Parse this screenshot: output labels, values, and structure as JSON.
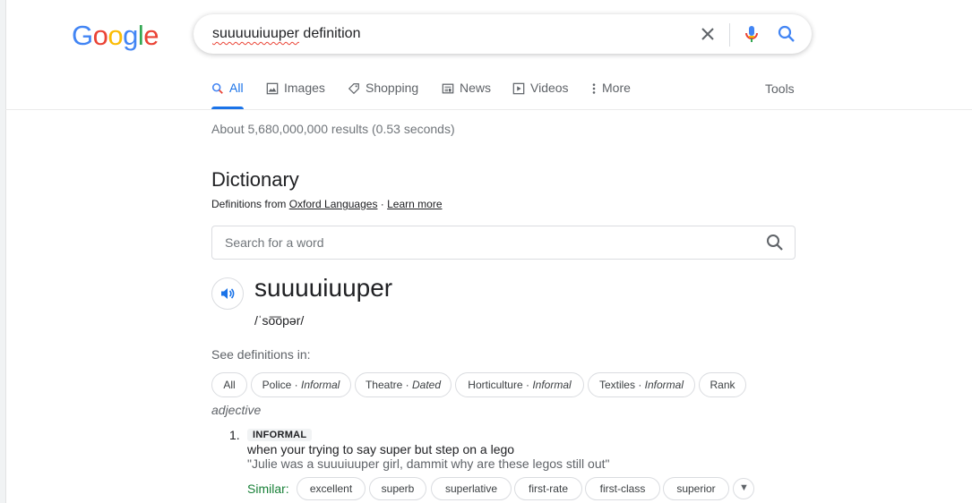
{
  "logo": {
    "letters": [
      "G",
      "o",
      "o",
      "g",
      "l",
      "e"
    ]
  },
  "search": {
    "query": "suuuuuiuuper",
    "query_rest": " definition",
    "clear_icon": "close-icon",
    "voice_icon": "mic-icon",
    "search_icon": "search-icon"
  },
  "tabs": [
    {
      "label": "All",
      "icon": "search-icon"
    },
    {
      "label": "Images",
      "icon": "image-icon"
    },
    {
      "label": "Shopping",
      "icon": "tag-icon"
    },
    {
      "label": "News",
      "icon": "newspaper-icon"
    },
    {
      "label": "Videos",
      "icon": "play-icon"
    },
    {
      "label": "More",
      "icon": "more-vert-icon"
    }
  ],
  "tools_label": "Tools",
  "stats": "About 5,680,000,000 results (0.53 seconds)",
  "dictionary": {
    "title": "Dictionary",
    "source_prefix": "Definitions from ",
    "source_link": "Oxford Languages",
    "source_sep": " · ",
    "learn_more": "Learn more",
    "word_search_placeholder": "Search for a word",
    "headword": "suuuuiuuper",
    "phonetic": "/ˈso͞opər/",
    "see_defs_label": "See definitions in:",
    "domains": [
      {
        "label": "All",
        "tag": ""
      },
      {
        "label": "Police",
        "tag": "Informal"
      },
      {
        "label": "Theatre",
        "tag": "Dated"
      },
      {
        "label": "Horticulture",
        "tag": "Informal"
      },
      {
        "label": "Textiles",
        "tag": "Informal"
      },
      {
        "label": "Rank",
        "tag": ""
      }
    ],
    "tag_sep": " · ",
    "part_of_speech": "adjective",
    "sense": {
      "number": "1.",
      "register": "INFORMAL",
      "definition": "when your trying to say super but step on a lego",
      "example": "\"Julie was a suuuiuuper girl, dammit why are these legos still out\"",
      "similar_label": "Similar:",
      "similar": [
        "excellent",
        "superb",
        "superlative",
        "first-rate",
        "first-class",
        "superior"
      ]
    }
  },
  "colors": {
    "blue": "#4285F4",
    "red": "#EA4335",
    "yellow": "#FBBC05",
    "green": "#34A853",
    "accent": "#1a73e8"
  }
}
